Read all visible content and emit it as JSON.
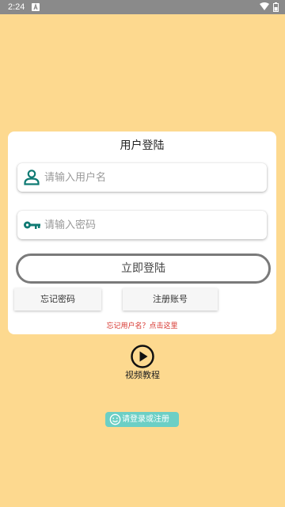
{
  "status_bar": {
    "time": "2:24",
    "icons": [
      "app-notification-icon",
      "wifi-icon",
      "battery-icon"
    ]
  },
  "login_card": {
    "title": "用户登陆",
    "username": {
      "placeholder": "请输入用户名",
      "value": "",
      "icon": "user-icon"
    },
    "password": {
      "placeholder": "请输入密码",
      "value": "",
      "icon": "key-icon"
    },
    "login_button": "立即登陆",
    "forgot_password_button": "忘记密码",
    "register_button": "注册账号",
    "forgot_username_link": "忘记用户名？点击这里"
  },
  "video_tutorial": {
    "label": "视频教程",
    "icon": "play-icon"
  },
  "hint": {
    "text": "请登录或注册",
    "icon": "smile-icon"
  },
  "colors": {
    "background": "#fdd98f",
    "icon_teal": "#0f7a73",
    "hint_bg": "#6ccfc5",
    "link_red": "#d6322b"
  }
}
